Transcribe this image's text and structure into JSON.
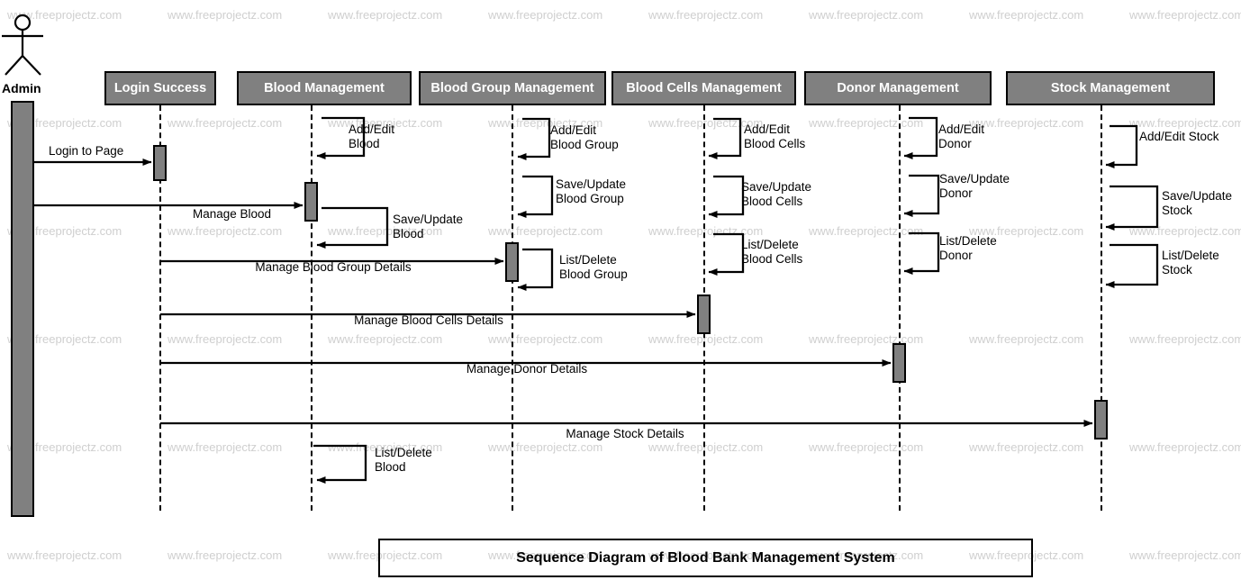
{
  "diagram": {
    "title": "Sequence Diagram of Blood Bank Management System",
    "type": "uml-sequence-diagram",
    "colors": {
      "participant_fill": "#808080",
      "participant_text": "#ffffff",
      "activation_fill": "#808080",
      "line": "#000000",
      "watermark": "#cfcfcf",
      "background": "#ffffff"
    },
    "watermark_text": "www.freeprojectz.com"
  },
  "actor": {
    "name": "Admin",
    "icon": "stick-figure-actor-icon"
  },
  "participants": [
    {
      "id": "login",
      "label": "Login Success"
    },
    {
      "id": "blood",
      "label": "Blood Management"
    },
    {
      "id": "bloodgroup",
      "label": "Blood Group Management"
    },
    {
      "id": "bloodcells",
      "label": "Blood Cells Management"
    },
    {
      "id": "donor",
      "label": "Donor Management"
    },
    {
      "id": "stock",
      "label": "Stock Management"
    }
  ],
  "messages": [
    {
      "id": "m1",
      "kind": "call",
      "from": "Admin",
      "to": "login",
      "label": "Login to Page"
    },
    {
      "id": "m2",
      "kind": "call",
      "from": "Admin",
      "to": "blood",
      "label": "Manage Blood"
    },
    {
      "id": "m3",
      "kind": "call",
      "from": "Admin",
      "to": "bloodgroup",
      "label": "Manage Blood Group Details"
    },
    {
      "id": "m4",
      "kind": "call",
      "from": "Admin",
      "to": "bloodcells",
      "label": "Manage Blood Cells Details"
    },
    {
      "id": "m5",
      "kind": "call",
      "from": "Admin",
      "to": "donor",
      "label": "Manage Donor Details"
    },
    {
      "id": "m6",
      "kind": "call",
      "from": "Admin",
      "to": "stock",
      "label": "Manage Stock Details"
    }
  ],
  "self_messages": [
    {
      "id": "s1",
      "on": "blood",
      "line1": "Add/Edit",
      "line2": "Blood"
    },
    {
      "id": "s2",
      "on": "blood",
      "line1": "Save/Update",
      "line2": "Blood"
    },
    {
      "id": "s3",
      "on": "blood",
      "line1": "List/Delete",
      "line2": "Blood"
    },
    {
      "id": "s4",
      "on": "bloodgroup",
      "line1": "Add/Edit",
      "line2": "Blood Group"
    },
    {
      "id": "s5",
      "on": "bloodgroup",
      "line1": "Save/Update",
      "line2": "Blood Group"
    },
    {
      "id": "s6",
      "on": "bloodgroup",
      "line1": "List/Delete",
      "line2": "Blood Group"
    },
    {
      "id": "s7",
      "on": "bloodcells",
      "line1": "Add/Edit",
      "line2": "Blood Cells"
    },
    {
      "id": "s8",
      "on": "bloodcells",
      "line1": "Save/Update",
      "line2": "Blood Cells"
    },
    {
      "id": "s9",
      "on": "bloodcells",
      "line1": "List/Delete",
      "line2": "Blood Cells"
    },
    {
      "id": "s10",
      "on": "donor",
      "line1": "Add/Edit",
      "line2": "Donor"
    },
    {
      "id": "s11",
      "on": "donor",
      "line1": "Save/Update",
      "line2": "Donor"
    },
    {
      "id": "s12",
      "on": "donor",
      "line1": "List/Delete",
      "line2": "Donor"
    },
    {
      "id": "s13",
      "on": "stock",
      "line1": "Add/Edit Stock",
      "line2": ""
    },
    {
      "id": "s14",
      "on": "stock",
      "line1": "Save/Update",
      "line2": "Stock"
    },
    {
      "id": "s15",
      "on": "stock",
      "line1": "List/Delete",
      "line2": "Stock"
    }
  ]
}
